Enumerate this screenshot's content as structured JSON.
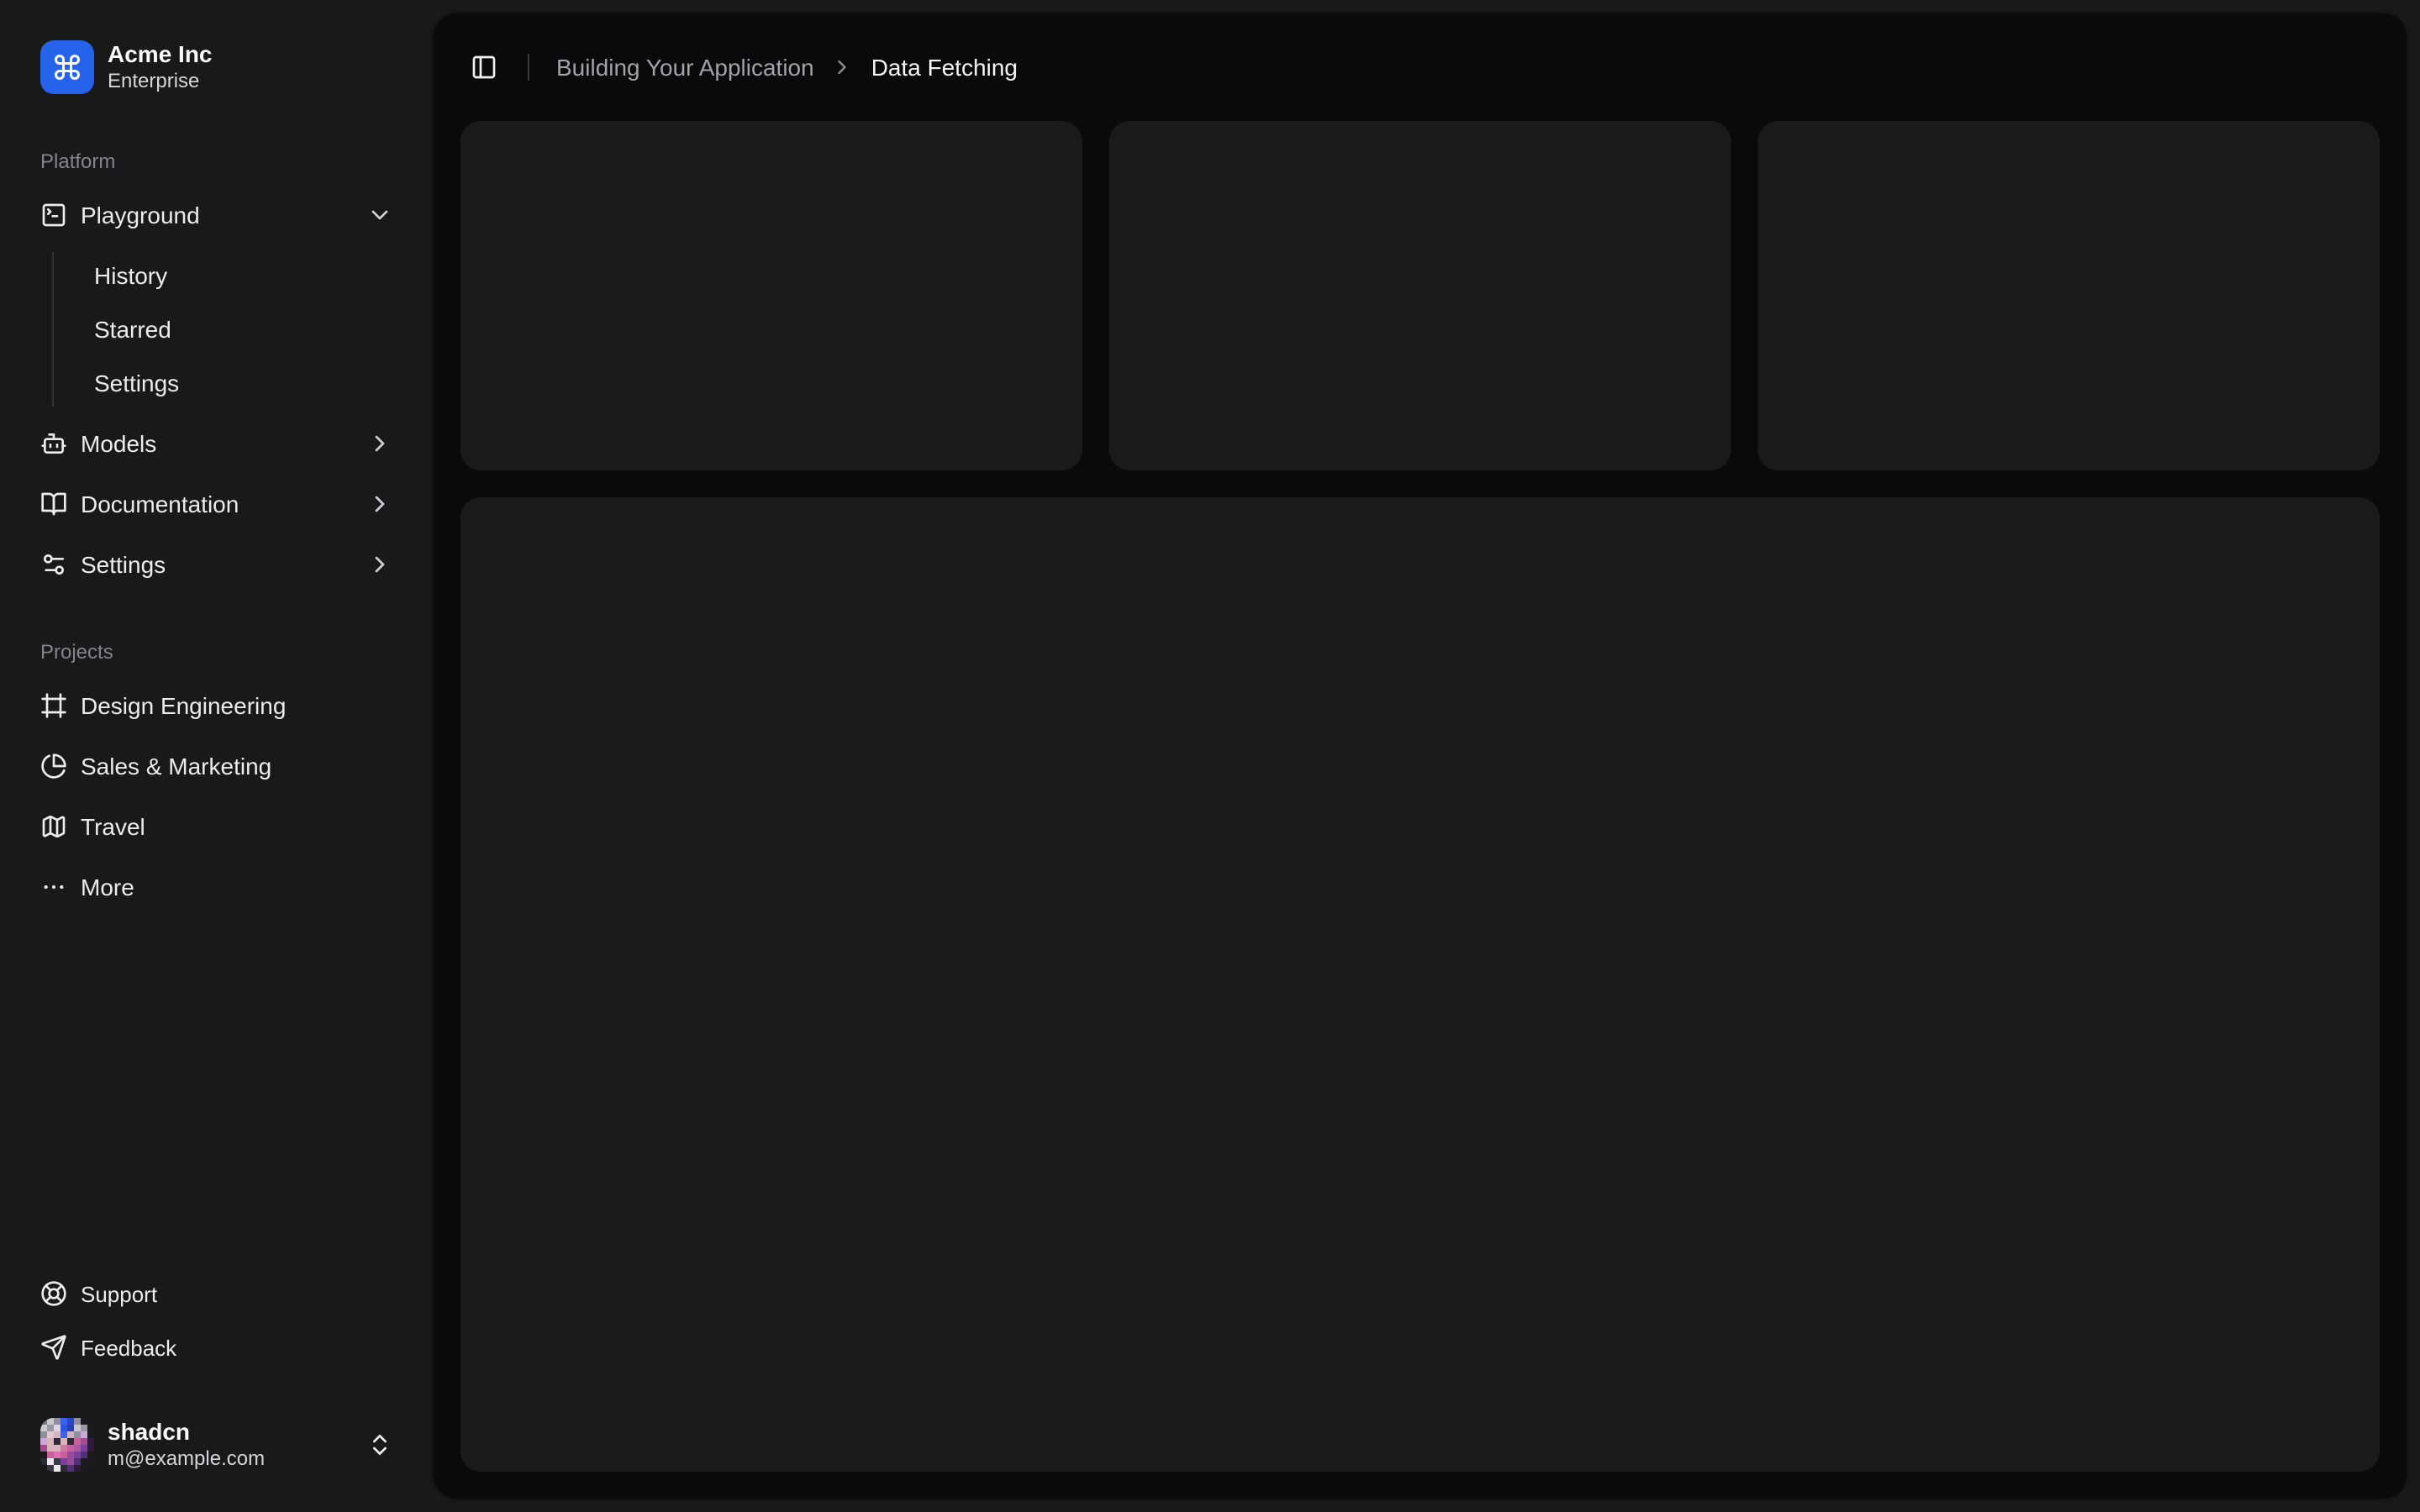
{
  "team": {
    "name": "Acme Inc",
    "plan": "Enterprise"
  },
  "nav_main": {
    "label": "Platform",
    "items": [
      {
        "label": "Playground",
        "icon": "square-terminal-icon",
        "expanded": true,
        "children": [
          "History",
          "Starred",
          "Settings"
        ]
      },
      {
        "label": "Models",
        "icon": "bot-icon"
      },
      {
        "label": "Documentation",
        "icon": "book-open-icon"
      },
      {
        "label": "Settings",
        "icon": "sliders-icon"
      }
    ]
  },
  "projects": {
    "label": "Projects",
    "items": [
      {
        "label": "Design Engineering",
        "icon": "frame-icon"
      },
      {
        "label": "Sales & Marketing",
        "icon": "pie-chart-icon"
      },
      {
        "label": "Travel",
        "icon": "map-icon"
      },
      {
        "label": "More",
        "icon": "ellipsis-icon"
      }
    ]
  },
  "nav_secondary": [
    {
      "label": "Support",
      "icon": "life-buoy-icon"
    },
    {
      "label": "Feedback",
      "icon": "send-icon"
    }
  ],
  "user": {
    "name": "shadcn",
    "email": "m@example.com"
  },
  "breadcrumb": {
    "parent": "Building Your Application",
    "current": "Data Fetching"
  },
  "colors": {
    "sidebar_bg": "#191919",
    "panel_bg": "#0a0a0a",
    "card_bg": "#1a1a1a",
    "brand_blue": "#2563eb",
    "text_primary": "#fafafa",
    "text_muted": "#a2a2a8"
  }
}
